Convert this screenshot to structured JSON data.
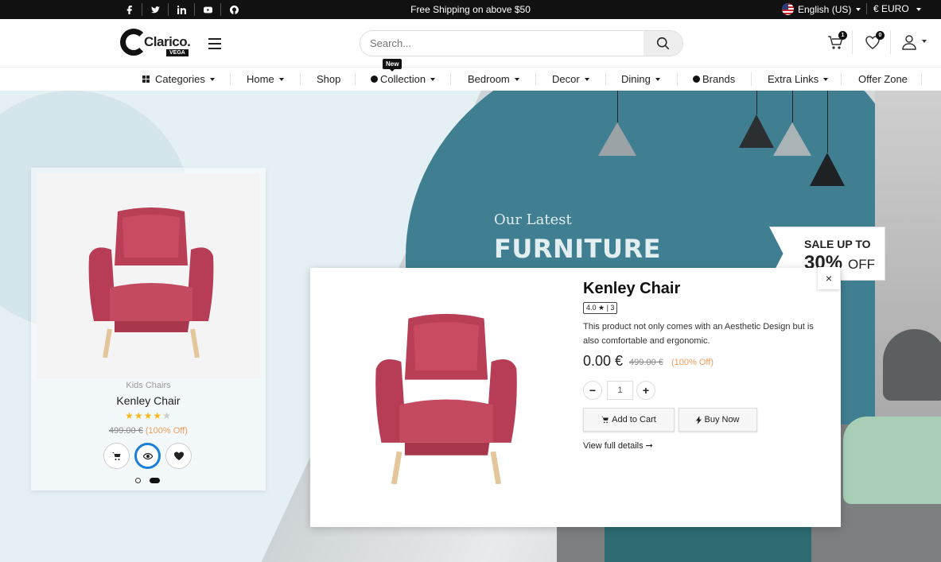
{
  "topbar": {
    "social_icons": [
      "facebook-icon",
      "twitter-icon",
      "linkedin-icon",
      "youtube-icon",
      "github-icon"
    ],
    "shipping_text": "Free Shipping on above $50",
    "language": "English (US)",
    "currency": "€ EURO"
  },
  "header": {
    "logo_text": "Clarico.",
    "logo_sub": "VEGA",
    "search_placeholder": "Search...",
    "cart_count": "1",
    "wishlist_count": "0"
  },
  "nav": {
    "new_badge": "New",
    "items": [
      "Categories",
      "Home",
      "Shop",
      "Collection",
      "Bedroom",
      "Decor",
      "Dining",
      "Brands",
      "Extra Links",
      "Offer Zone"
    ]
  },
  "hero": {
    "line1": "Our Latest",
    "line2": "FURNITURE",
    "tag_line1": "SALE UP TO",
    "tag_line2": "30%",
    "tag_line3": "OFF"
  },
  "card": {
    "category": "Kids Chairs",
    "name": "Kenley Chair",
    "stars": "★★★★★",
    "old_price": "499.00 €",
    "discount": "(100% Off)"
  },
  "modal": {
    "close": "×",
    "title": "Kenley Chair",
    "rating": "4.0 ★ | 3",
    "description": "This product not only comes with an Aesthetic Design but is also comfortable and ergonomic.",
    "price": "0.00 €",
    "old_price": "499.00 €",
    "discount": "(100% Off)",
    "qty_minus": "−",
    "qty_value": "1",
    "qty_plus": "+",
    "add_to_cart": "Add to Cart",
    "buy_now": "Buy Now",
    "view_details": "View full details ➞"
  },
  "colors": {
    "chair": "#c4485e",
    "accent_blue": "#1a7fd6",
    "discount": "#f39c5a"
  }
}
